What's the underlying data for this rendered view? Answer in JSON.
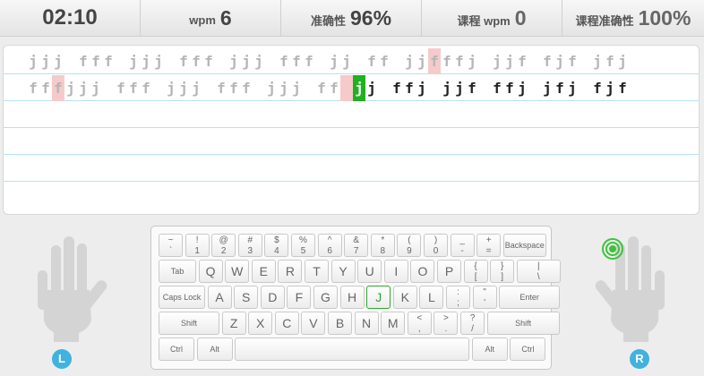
{
  "stats": {
    "timer": "02:10",
    "wpm_label": "wpm",
    "wpm_value": "6",
    "accuracy_label": "准确性",
    "accuracy_value": "96%",
    "course_wpm_label": "课程 wpm",
    "course_wpm_value": "0",
    "course_accuracy_label": "课程准确性",
    "course_accuracy_value": "100%"
  },
  "lines": [
    [
      {
        "t": "jjj",
        "s": "done"
      },
      {
        "t": "fff",
        "s": "done"
      },
      {
        "t": "jjj",
        "s": "done"
      },
      {
        "t": "fff",
        "s": "done"
      },
      {
        "t": "jjj",
        "s": "done"
      },
      {
        "t": "fff",
        "s": "done"
      },
      {
        "t": "jj",
        "s": "done"
      },
      {
        "t": "ff",
        "s": "done"
      },
      {
        "t": "jj",
        "s": "done"
      },
      {
        "t": "f",
        "s": "err"
      },
      {
        "t": "ffj",
        "s": "done"
      },
      {
        "t": "jjf",
        "s": "done"
      },
      {
        "t": "fjf",
        "s": "done"
      },
      {
        "t": "jfj",
        "s": "done"
      }
    ],
    [
      {
        "t": "ff",
        "s": "done"
      },
      {
        "t": "f",
        "s": "err"
      },
      {
        "t": "jjj",
        "s": "done"
      },
      {
        "t": "fff",
        "s": "done"
      },
      {
        "t": "jjj",
        "s": "done"
      },
      {
        "t": "fff",
        "s": "done"
      },
      {
        "t": "jjj",
        "s": "done"
      },
      {
        "t": "ff",
        "s": "done"
      },
      {
        "t": " ",
        "s": "err"
      },
      {
        "t": "j",
        "s": "cur"
      },
      {
        "t": "j",
        "s": "todo"
      },
      {
        "t": "ffj",
        "s": "todo"
      },
      {
        "t": "jjf",
        "s": "todo"
      },
      {
        "t": "ffj",
        "s": "todo"
      },
      {
        "t": "jfj",
        "s": "todo"
      },
      {
        "t": "fjf",
        "s": "todo"
      }
    ],
    [],
    [],
    []
  ],
  "keyboard": {
    "rows": [
      [
        {
          "top": "~",
          "bot": "`"
        },
        {
          "top": "!",
          "bot": "1"
        },
        {
          "top": "@",
          "bot": "2"
        },
        {
          "top": "#",
          "bot": "3"
        },
        {
          "top": "$",
          "bot": "4"
        },
        {
          "top": "%",
          "bot": "5"
        },
        {
          "top": "^",
          "bot": "6"
        },
        {
          "top": "&",
          "bot": "7"
        },
        {
          "top": "*",
          "bot": "8"
        },
        {
          "top": "(",
          "bot": "9"
        },
        {
          "top": ")",
          "bot": "0"
        },
        {
          "top": "_",
          "bot": "-"
        },
        {
          "top": "+",
          "bot": "="
        },
        {
          "label": "Backspace",
          "small": true
        }
      ],
      [
        {
          "label": "Tab",
          "small": true
        },
        {
          "label": "Q"
        },
        {
          "label": "W"
        },
        {
          "label": "E"
        },
        {
          "label": "R"
        },
        {
          "label": "T"
        },
        {
          "label": "Y"
        },
        {
          "label": "U"
        },
        {
          "label": "I"
        },
        {
          "label": "O"
        },
        {
          "label": "P"
        },
        {
          "top": "{",
          "bot": "["
        },
        {
          "top": "}",
          "bot": "]"
        },
        {
          "top": "|",
          "bot": "\\"
        }
      ],
      [
        {
          "label": "Caps Lock",
          "small": true
        },
        {
          "label": "A"
        },
        {
          "label": "S"
        },
        {
          "label": "D"
        },
        {
          "label": "F"
        },
        {
          "label": "G"
        },
        {
          "label": "H"
        },
        {
          "label": "J",
          "highlight": true
        },
        {
          "label": "K"
        },
        {
          "label": "L"
        },
        {
          "top": ":",
          "bot": ";"
        },
        {
          "top": "\"",
          "bot": "'"
        },
        {
          "label": "Enter",
          "small": true
        }
      ],
      [
        {
          "label": "Shift",
          "small": true
        },
        {
          "label": "Z"
        },
        {
          "label": "X"
        },
        {
          "label": "C"
        },
        {
          "label": "V"
        },
        {
          "label": "B"
        },
        {
          "label": "N"
        },
        {
          "label": "M"
        },
        {
          "top": "<",
          "bot": ","
        },
        {
          "top": ">",
          "bot": "."
        },
        {
          "top": "?",
          "bot": "/"
        },
        {
          "label": "Shift",
          "small": true
        }
      ],
      [
        {
          "label": "Ctrl",
          "small": true
        },
        {
          "label": "Alt",
          "small": true
        },
        {
          "label": ""
        },
        {
          "label": "Alt",
          "small": true
        },
        {
          "label": "Ctrl",
          "small": true
        }
      ]
    ]
  },
  "hands": {
    "left_badge": "L",
    "right_badge": "R",
    "active_finger": "right-index",
    "hand_color": "#d4d4d4",
    "target_color": "#3cc23c"
  }
}
